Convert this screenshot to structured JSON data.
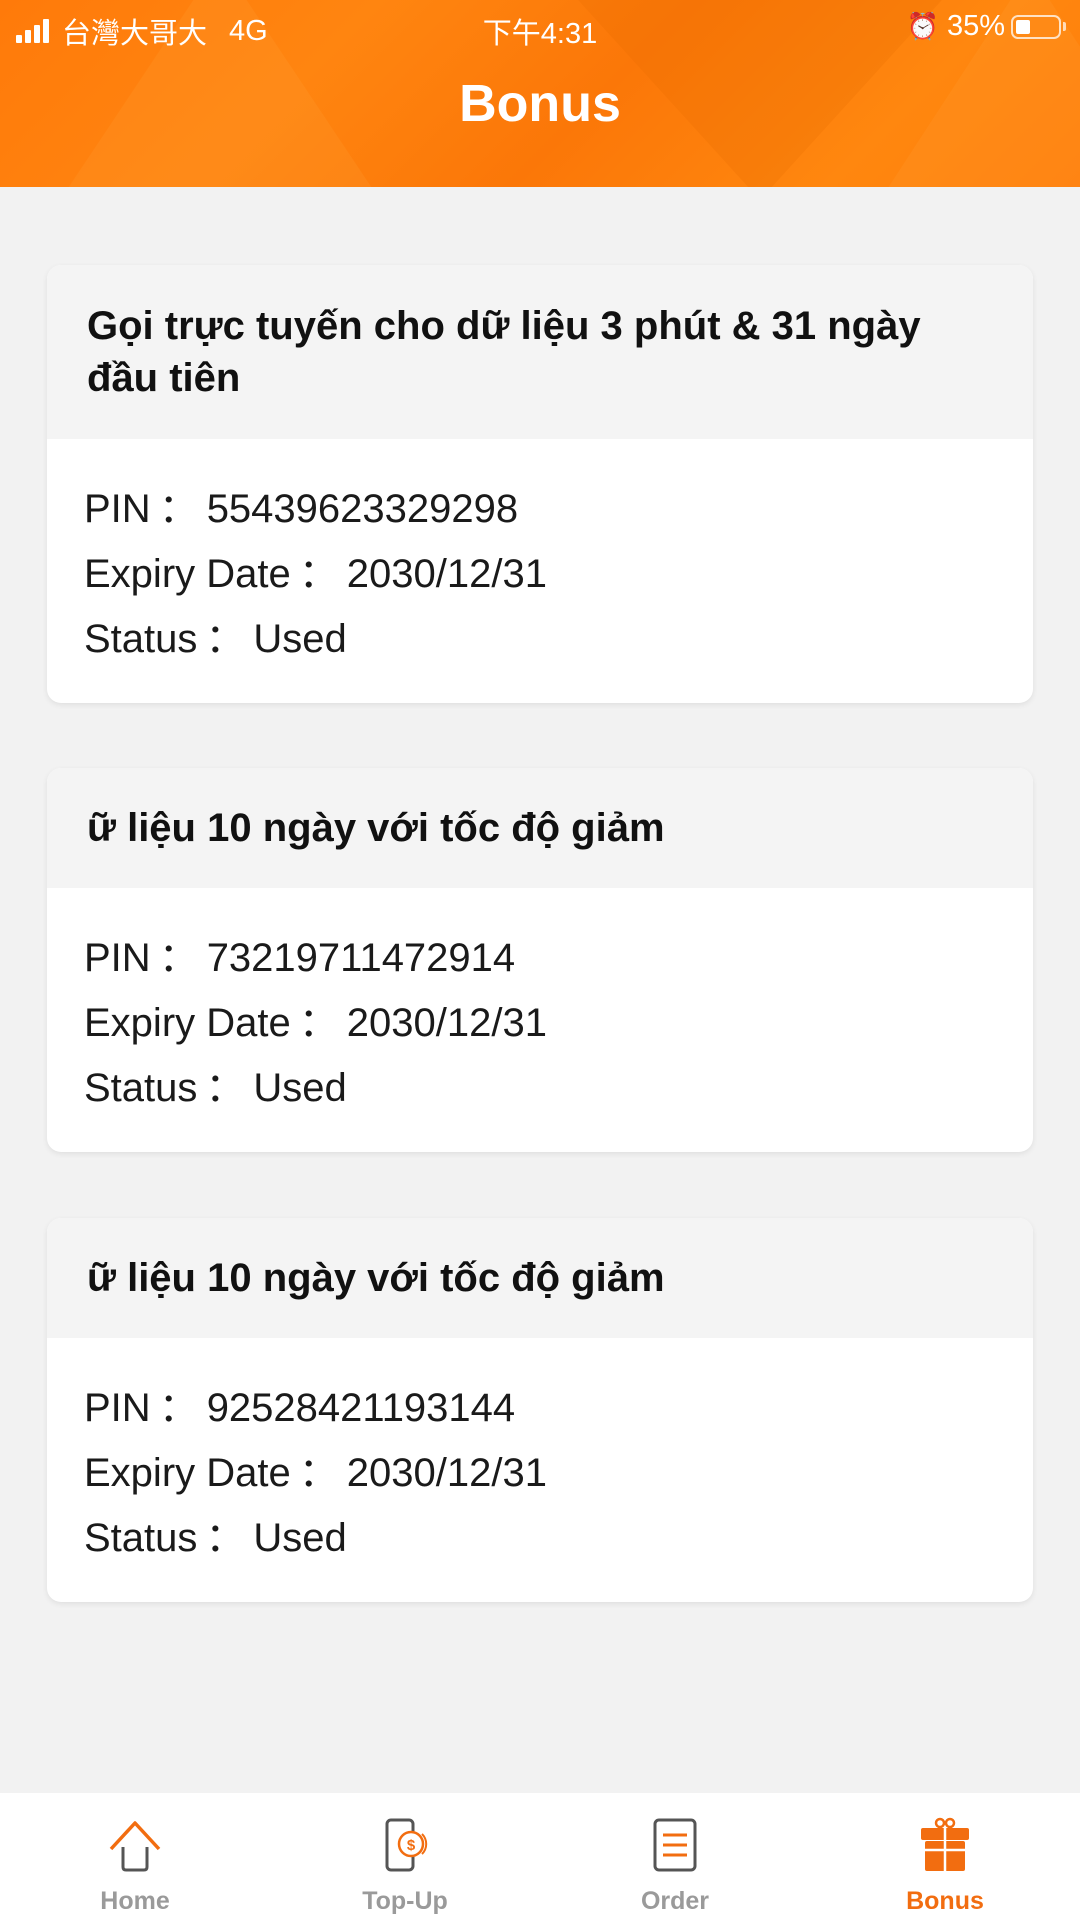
{
  "status_bar": {
    "carrier": "台灣大哥大",
    "network": "4G",
    "time": "下午4:31",
    "battery_percent": "35%",
    "battery_level": 0.35,
    "alarm_icon": "alarm-clock-icon"
  },
  "header": {
    "title": "Bonus",
    "accent_color": "#ff7d0a"
  },
  "cards": [
    {
      "title": "Gọi trực tuyến cho dữ liệu 3 phút & 31 ngày đầu tiên",
      "pin_label": "PIN",
      "pin": "55439623329298",
      "expiry_label": "Expiry Date",
      "expiry": "2030/12/31",
      "status_label": "Status",
      "status": "Used"
    },
    {
      "title": "ữ liệu 10 ngày với tốc độ giảm",
      "pin_label": "PIN",
      "pin": "73219711472914",
      "expiry_label": "Expiry Date",
      "expiry": "2030/12/31",
      "status_label": "Status",
      "status": "Used"
    },
    {
      "title": "ữ liệu 10 ngày với tốc độ giảm",
      "pin_label": "PIN",
      "pin": "92528421193144",
      "expiry_label": "Expiry Date",
      "expiry": "2030/12/31",
      "status_label": "Status",
      "status": "Used"
    }
  ],
  "separator": "：",
  "tabbar": {
    "items": [
      {
        "label": "Home",
        "icon": "home-icon",
        "active": false
      },
      {
        "label": "Top-Up",
        "icon": "phone-coin-icon",
        "active": false
      },
      {
        "label": "Order",
        "icon": "order-list-icon",
        "active": false
      },
      {
        "label": "Bonus",
        "icon": "gift-icon",
        "active": true
      }
    ],
    "active_color": "#f26d10",
    "inactive_color": "#9a9a9a"
  }
}
